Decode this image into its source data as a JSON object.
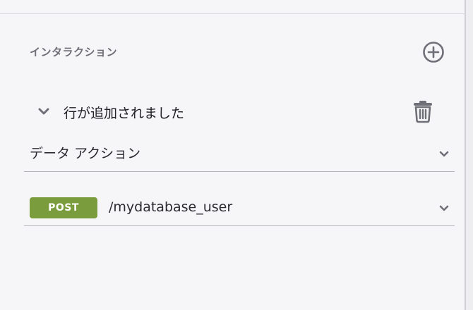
{
  "panel": {
    "section_title": "インタラクション"
  },
  "interaction": {
    "event_title": "行が追加されました",
    "action_select": "データ アクション",
    "method": "POST",
    "endpoint": "/mydatabase_user"
  },
  "icons": {
    "add": "plus-circle-icon",
    "collapse": "chevron-down-icon",
    "delete": "trash-icon",
    "dropdown": "chevron-down-icon"
  },
  "colors": {
    "background": "#f6f6f9",
    "icon": "#6f6f78",
    "method_badge": "#7a9c3c",
    "divider": "#b5b5bb"
  }
}
